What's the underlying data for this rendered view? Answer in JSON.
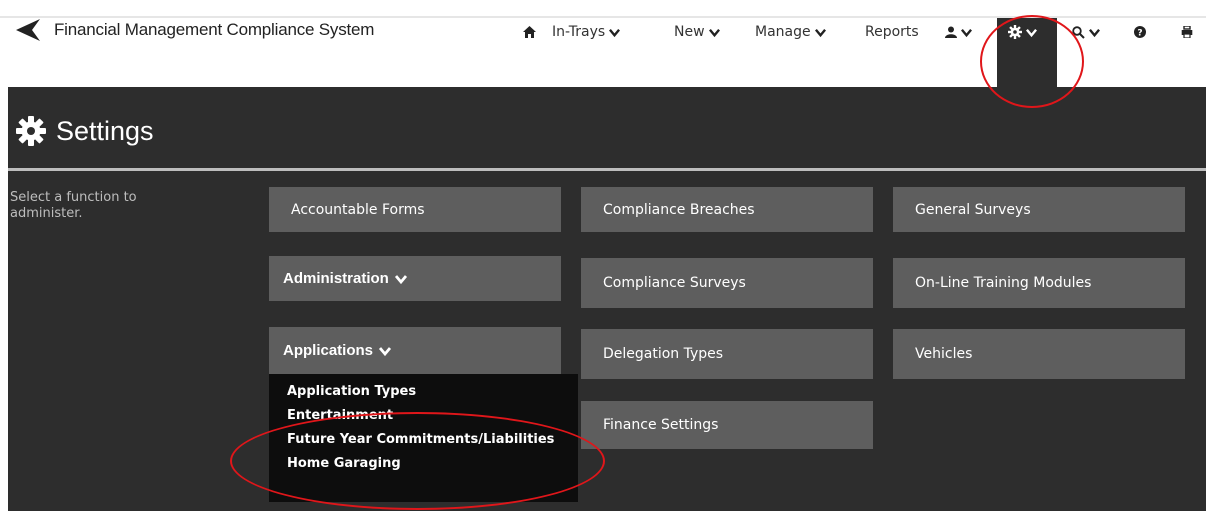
{
  "app": {
    "title": "Financial Management Compliance System"
  },
  "nav": {
    "items": [
      {
        "label": "",
        "icon": "home-icon"
      },
      {
        "label": "In-Trays"
      },
      {
        "label": "New"
      },
      {
        "label": "Manage"
      },
      {
        "label": "Reports"
      },
      {
        "label": "",
        "icon": "user-icon"
      },
      {
        "label": "",
        "icon": "settings-gear-icon",
        "active": true
      },
      {
        "label": "",
        "icon": "search-icon"
      },
      {
        "label": "",
        "icon": "help-icon"
      },
      {
        "label": "",
        "icon": "print-icon"
      }
    ]
  },
  "page": {
    "title": "Settings",
    "instructions": "Select a function to administer."
  },
  "tiles": {
    "col1": [
      "Accountable Forms",
      "Administration",
      "Applications"
    ],
    "col2": [
      "Compliance Breaches",
      "Compliance Surveys",
      "Delegation Types",
      "Finance Settings"
    ],
    "col3": [
      "General Surveys",
      "On-Line Training Modules",
      "Vehicles"
    ]
  },
  "applications_menu": {
    "items": [
      "Application Types",
      "Entertainment",
      "Future Year Commitments/Liabilities",
      "Home Garaging"
    ]
  },
  "colors": {
    "dark_bg": "#2d2d2d",
    "tile_bg": "#5e5e5e",
    "dropdown_bg": "#0d0d0d",
    "annotation": "#e0161a"
  }
}
